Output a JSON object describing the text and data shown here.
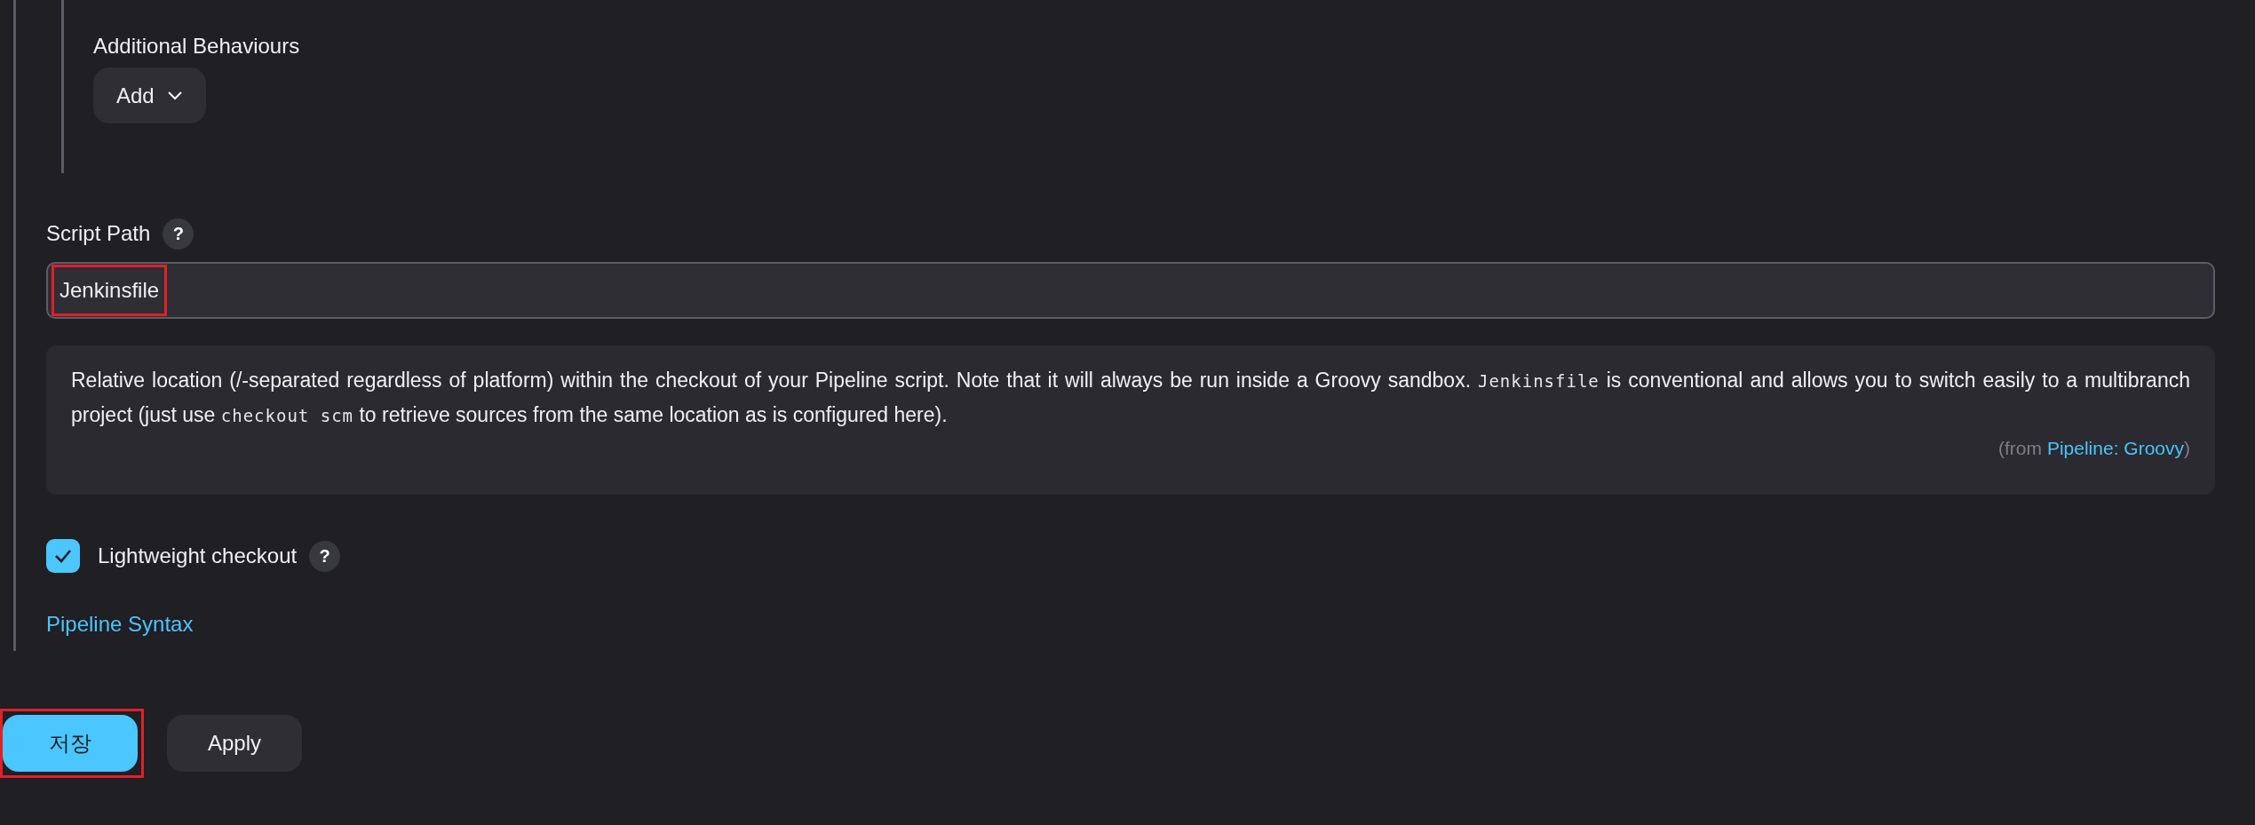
{
  "additional_behaviours": {
    "label": "Additional Behaviours",
    "add_button": "Add"
  },
  "script_path": {
    "label": "Script Path",
    "help": "?",
    "value": "Jenkinsfile",
    "highlighted": true
  },
  "help_box": {
    "segments": [
      {
        "kind": "text",
        "text": "Relative location (/-separated regardless of platform) within the checkout of your Pipeline script. Note that it will always be run inside a Groovy sandbox."
      },
      {
        "kind": "code",
        "text": "Jenkinsfile"
      },
      {
        "kind": "text",
        "text": "is conventional and allows you to switch easily to a multibranch project (just use"
      },
      {
        "kind": "code",
        "text": "checkout scm"
      },
      {
        "kind": "text",
        "text": "to retrieve sources from the same location as is configured here)."
      }
    ],
    "attribution": {
      "prefix": "(from",
      "link": "Pipeline: Groovy",
      "suffix": ")"
    }
  },
  "lightweight_checkout": {
    "label": "Lightweight checkout",
    "checked": true,
    "help": "?"
  },
  "pipeline_syntax_link": "Pipeline Syntax",
  "buttons": [
    {
      "label": "저장",
      "kind": "primary",
      "highlighted": true
    },
    {
      "label": "Apply",
      "kind": "secondary",
      "highlighted": false
    }
  ]
}
